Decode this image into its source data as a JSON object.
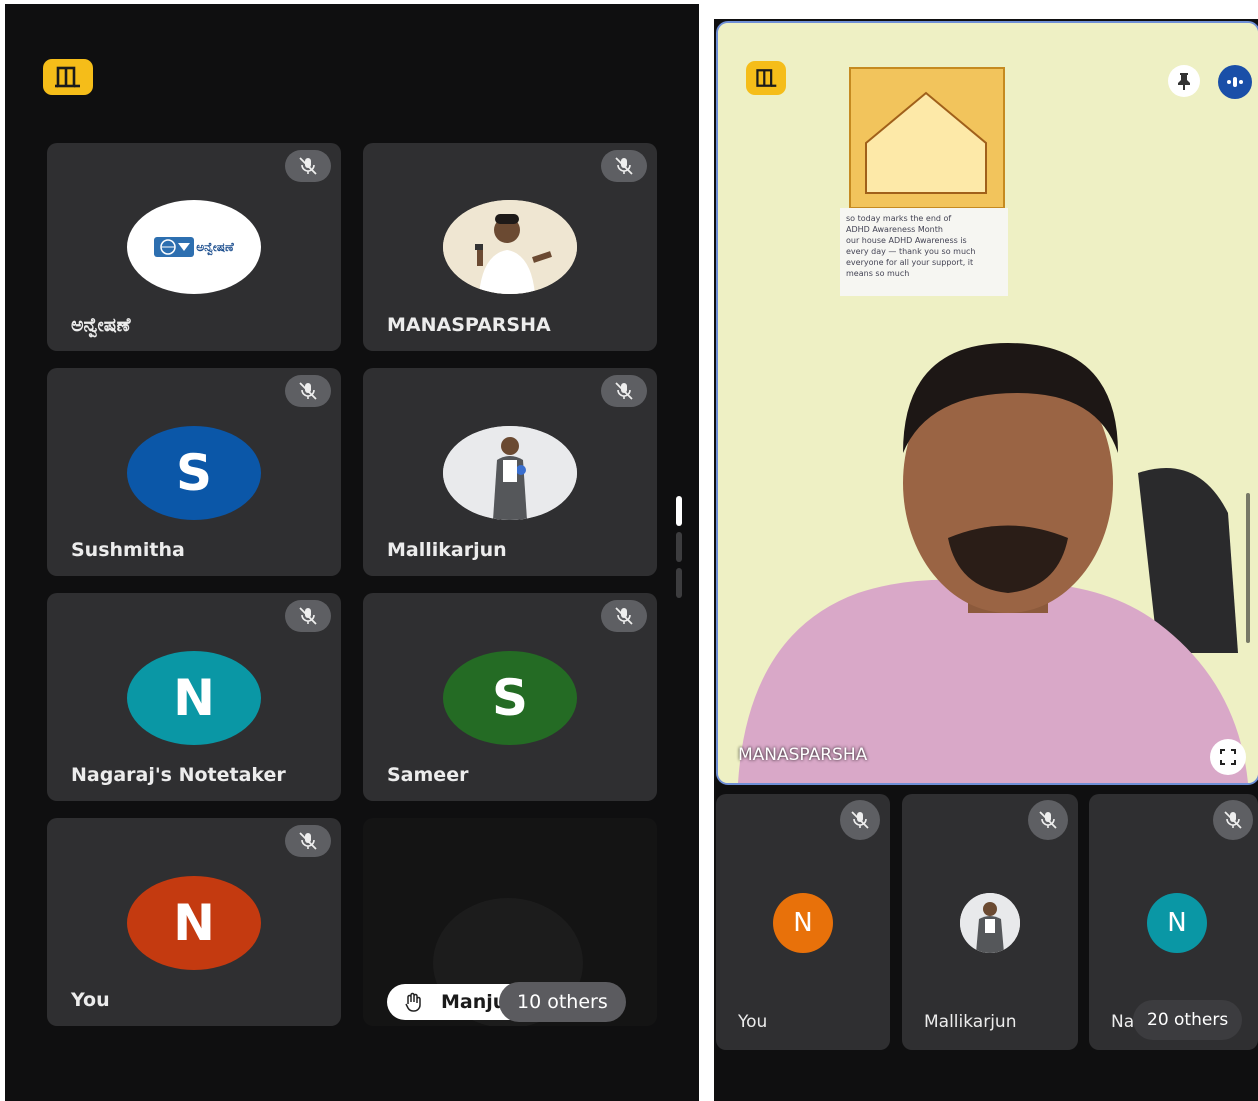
{
  "colors": {
    "background": "#0f0f10",
    "tile": "#2f2f31",
    "badge": "#f5bd19",
    "mic_off": "#5e5f63",
    "avatar_blue": "#0b57a8",
    "avatar_teal": "#0a97a5",
    "avatar_green": "#246b24",
    "avatar_red": "#c43a10",
    "avatar_orange": "#e8710a",
    "speaking_outline": "#6f8fd6"
  },
  "left_screen": {
    "participants": [
      {
        "name": "ಅನ್ವೇಷಣೆ",
        "avatar_type": "logo",
        "logo_text": "ಅನ್ವೇಷಣೆ",
        "mic": "muted-icon"
      },
      {
        "name": "MANASPARSHA",
        "avatar_type": "photo",
        "mic": "muted-icon"
      },
      {
        "name": "Sushmitha",
        "avatar_type": "letter",
        "initial": "S",
        "mic": "muted-icon"
      },
      {
        "name": "Mallikarjun",
        "avatar_type": "photo",
        "mic": "muted-icon"
      },
      {
        "name": "Nagaraj's Notetaker",
        "avatar_type": "letter",
        "initial": "N",
        "mic": "muted-icon"
      },
      {
        "name": "Sameer",
        "avatar_type": "letter",
        "initial": "S",
        "mic": "muted-icon"
      },
      {
        "name": "You",
        "avatar_type": "letter",
        "initial": "N",
        "mic": "muted-icon"
      }
    ],
    "overflow_tile": {
      "raised_hand_name": "Manju",
      "others_label": "10 others"
    }
  },
  "right_screen": {
    "speaker_name": "MANASPARSHA",
    "poster_lines": [
      "so today marks the end of",
      "ADHD Awareness Month",
      "our house ADHD Awareness is",
      "every day — thank you so much",
      "everyone for all your support, it",
      "means so much"
    ],
    "bottom_tiles": [
      {
        "name": "You",
        "avatar_type": "letter",
        "initial": "N"
      },
      {
        "name": "Mallikarjun",
        "avatar_type": "photo"
      },
      {
        "name": "Na",
        "avatar_type": "letter",
        "initial": "N"
      }
    ],
    "others_label": "20 others"
  }
}
